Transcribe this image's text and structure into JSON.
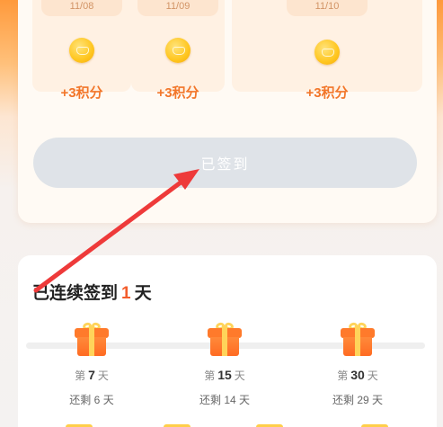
{
  "checkin": {
    "days": [
      {
        "date": "11/08",
        "points": "+3积分"
      },
      {
        "date": "11/09",
        "points": "+3积分"
      },
      {
        "date": "11/10",
        "points": "+3积分"
      }
    ],
    "signed_label": "已签到"
  },
  "streak": {
    "prefix": "已连续签到",
    "count": "1",
    "suffix": "天",
    "rewards": [
      {
        "day_prefix": "第",
        "day": "7",
        "day_suffix": "天",
        "left_prefix": "还剩",
        "left": "6",
        "left_suffix": "天"
      },
      {
        "day_prefix": "第",
        "day": "15",
        "day_suffix": "天",
        "left_prefix": "还剩",
        "left": "14",
        "left_suffix": "天"
      },
      {
        "day_prefix": "第",
        "day": "30",
        "day_suffix": "天",
        "left_prefix": "还剩",
        "left": "29",
        "left_suffix": "天"
      }
    ]
  },
  "colors": {
    "accent": "#f2762a",
    "streak_number": "#f35d2c",
    "button_disabled": "#dfe3e8",
    "annotation_arrow": "#ee3a3a"
  },
  "icons": {
    "coin": "gold-coin-icon",
    "gift": "gift-box-icon",
    "arrow": "red-annotation-arrow"
  }
}
